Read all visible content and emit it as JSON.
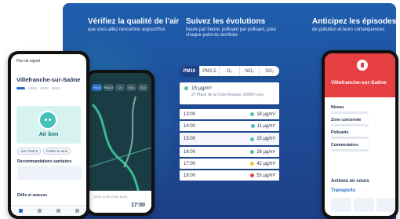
{
  "features": [
    {
      "title": "Vérifiez la qualité de l'air",
      "subtitle": "que vous allez rencontrer aujourd'hui"
    },
    {
      "title": "Suivez les évolutions",
      "subtitle": "heure par heure, polluant par polluant, pour chaque point du territoire"
    },
    {
      "title": "Anticipez les épisodes",
      "subtitle": "de pollution et leurs conséquences"
    }
  ],
  "pollutant_tabs": [
    {
      "label": "PM10",
      "active": true
    },
    {
      "label": "PM2,5",
      "active": false
    },
    {
      "label": "O₃",
      "active": false
    },
    {
      "label": "NO₂",
      "active": false
    },
    {
      "label": "SO₂",
      "active": false
    }
  ],
  "location": {
    "value": "15 µg/m³",
    "address": "27 Place de la Croix-Rousse, 69004 Lyon"
  },
  "hourly": [
    {
      "time": "13:00",
      "value": "18 µg/m³",
      "color": "#4cc0b5",
      "highlight": false
    },
    {
      "time": "14:00",
      "value": "11 µg/m³",
      "color": "#4cc0b5",
      "highlight": false
    },
    {
      "time": "15:00",
      "value": "15 µg/m³",
      "color": "#4cc0b5",
      "highlight": true
    },
    {
      "time": "16:00",
      "value": "28 µg/m³",
      "color": "#4cc0b5",
      "highlight": false
    },
    {
      "time": "17:00",
      "value": "42 µg/m³",
      "color": "#f2c230",
      "highlight": false
    },
    {
      "time": "18:00",
      "value": "53 µg/m³",
      "color": "#e74043",
      "highlight": false
    }
  ],
  "phone_left": {
    "status": "Pas de signal",
    "city": "Villefranche-sur-Saône",
    "air_label": "Air bon",
    "chips": [
      "Voir PM2,5",
      "Pollen à venir"
    ],
    "recommendations": "Recommandations sanitaires",
    "defis": "Défis et astuces"
  },
  "phone_map": {
    "tabs": [
      "PM10",
      "PM2,5",
      "O₃",
      "NO₂",
      "SO₂"
    ],
    "ticks": "10:00 12:00 15:00 18:00",
    "time": "17:00"
  },
  "phone_right": {
    "city": "Villefranche-sur-Saône",
    "fields": [
      "Niveau",
      "Zone concernée",
      "Polluants",
      "Commentaires"
    ],
    "actions": "Actions en cours",
    "transport": "Transports"
  }
}
